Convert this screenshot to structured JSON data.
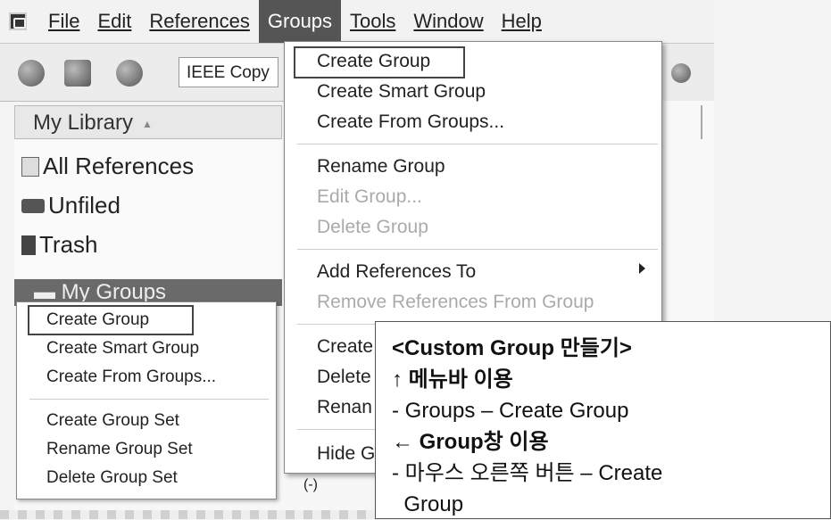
{
  "menubar": {
    "items": [
      "File",
      "Edit",
      "References",
      "Groups",
      "Tools",
      "Window",
      "Help"
    ]
  },
  "toolbar": {
    "style_value": "IEEE Copy"
  },
  "library": {
    "header": "My Library",
    "items": [
      "All References",
      "Unfiled",
      "Trash"
    ],
    "my_groups": "My Groups"
  },
  "groups_menu": {
    "items": [
      "Create Group",
      "Create Smart Group",
      "Create From Groups...",
      "Rename Group",
      "Edit Group...",
      "Delete Group",
      "Add References To",
      "Remove References From Group",
      "Create",
      "Delete",
      "Renan",
      "Hide G"
    ]
  },
  "context_menu": {
    "items": [
      "Create Group",
      "Create Smart Group",
      "Create From Groups...",
      "Create Group Set",
      "Rename Group Set",
      "Delete Group Set"
    ]
  },
  "annotation": {
    "title": "<Custom Group 만들기>",
    "line1": "↑ 메뉴바 이용",
    "line2": "-  Groups – Create Group",
    "line3": "← Group창 이용",
    "line4": "- 마우스 오른쪽 버튼 – Create",
    "line5": "  Group"
  }
}
